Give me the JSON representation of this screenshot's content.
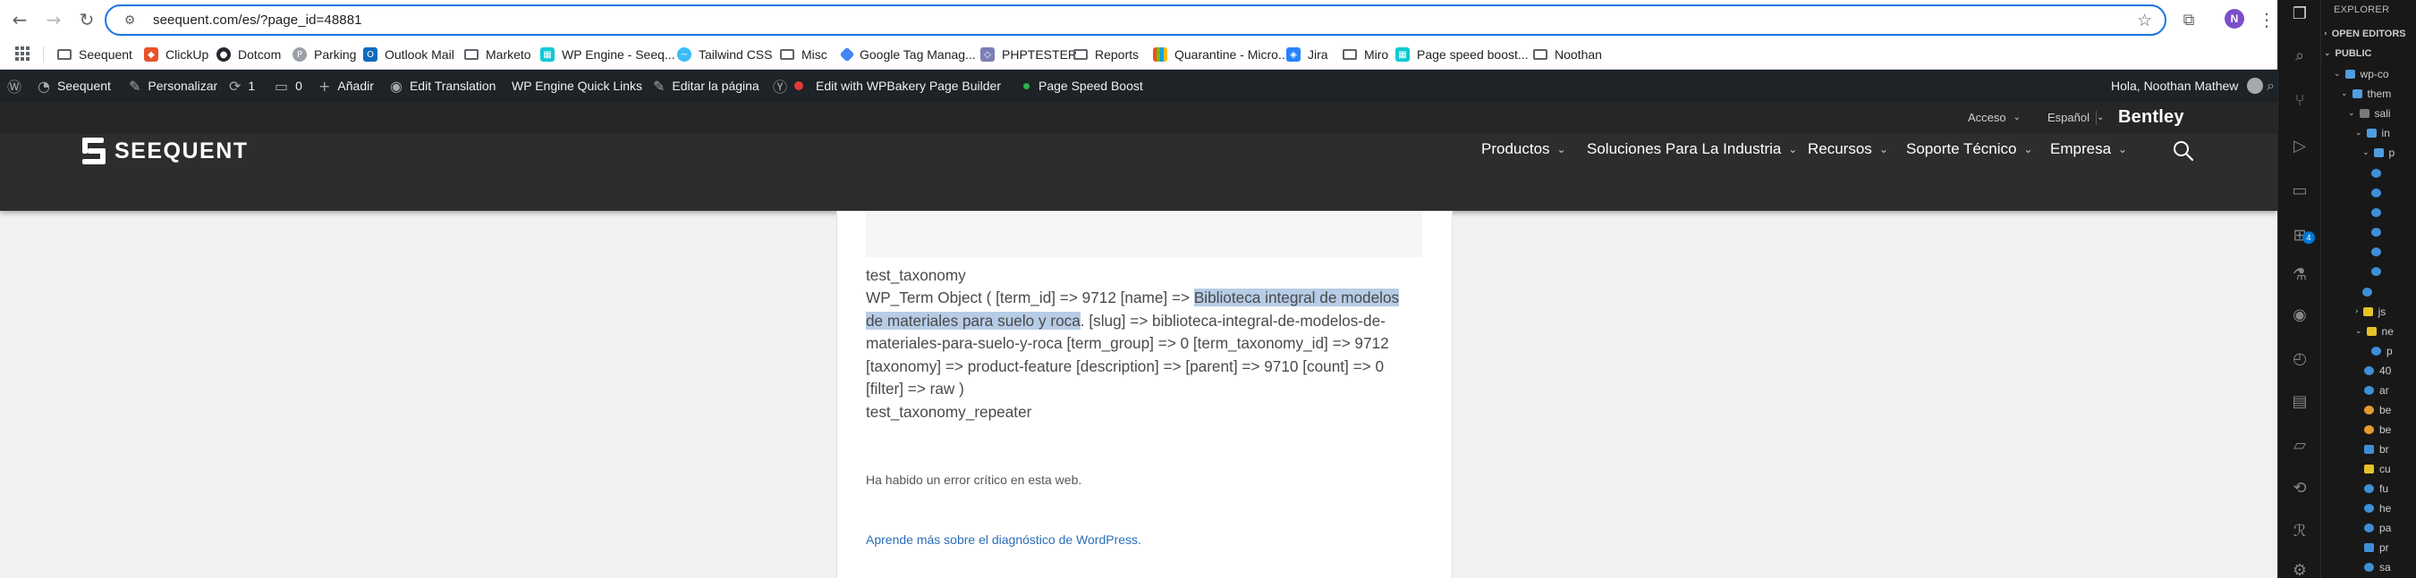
{
  "browser": {
    "url": "seequent.com/es/?page_id=48881",
    "profile_initial": "N",
    "bookmarks": [
      {
        "label": "Seequent",
        "icon": "folder-icon"
      },
      {
        "label": "ClickUp",
        "icon": "clickup-icon"
      },
      {
        "label": "Dotcom",
        "icon": "github-icon"
      },
      {
        "label": "Parking",
        "icon": "parking-icon"
      },
      {
        "label": "Outlook Mail",
        "icon": "outlook-icon"
      },
      {
        "label": "Marketo",
        "icon": "folder-icon"
      },
      {
        "label": "WP Engine - Seeq...",
        "icon": "wpengine-icon"
      },
      {
        "label": "Tailwind CSS",
        "icon": "tailwind-icon"
      },
      {
        "label": "Misc",
        "icon": "folder-icon"
      },
      {
        "label": "Google Tag Manag...",
        "icon": "gtm-icon"
      },
      {
        "label": "PHPTESTER",
        "icon": "php-icon"
      },
      {
        "label": "Reports",
        "icon": "folder-icon"
      },
      {
        "label": "Quarantine - Micro...",
        "icon": "microsoft-icon"
      },
      {
        "label": "Jira",
        "icon": "jira-icon"
      },
      {
        "label": "Miro",
        "icon": "folder-icon"
      },
      {
        "label": "Page speed boost...",
        "icon": "wpengine-icon"
      },
      {
        "label": "Noothan",
        "icon": "folder-icon"
      }
    ]
  },
  "admin_bar": {
    "site_name": "Seequent",
    "customize": "Personalizar",
    "updates_count": "1",
    "comments_count": "0",
    "add_new": "Añadir",
    "edit_translation": "Edit Translation",
    "wpe_links": "WP Engine Quick Links",
    "edit_page": "Editar la página",
    "wpbakery": "Edit with WPBakery Page Builder",
    "page_speed": "Page Speed Boost",
    "greeting": "Hola, Noothan Mathew"
  },
  "site_header": {
    "access": "Acceso",
    "language": "Español",
    "bentley": "Bentley",
    "logo_text": "SEEQUENT",
    "nav": [
      "Productos",
      "Soluciones Para La Industria",
      "Recursos",
      "Soporte Técnico",
      "Empresa"
    ]
  },
  "content": {
    "label_taxonomy": "test_taxonomy",
    "dump_prefix": "WP_Term Object ( [term_id] => 9712 [name] => ",
    "dump_highlight_1": "Biblioteca integral de modelos",
    "dump_highlight_2": "de materiales para suelo y roca",
    "dump_line2_rest": ". [slug] => biblioteca-integral-de-modelos-de-",
    "dump_line3": "materiales-para-suelo-y-roca [term_group] => 0 [term_taxonomy_id] => 9712",
    "dump_line4": "[taxonomy] => product-feature [description] => [parent] => 9710 [count] => 0",
    "dump_line5": "[filter] => raw )",
    "label_repeater": "test_taxonomy_repeater",
    "error_message": "Ha habido un error crítico en esta web.",
    "learn_more_link": "Aprende más sobre el diagnóstico de WordPress."
  },
  "vscode": {
    "explorer_title": "EXPLORER",
    "open_editors": "OPEN EDITORS",
    "tree": [
      {
        "label": "PUBLIC",
        "level": 0
      },
      {
        "label": "wp-co",
        "level": 1
      },
      {
        "label": "them",
        "level": 2
      },
      {
        "label": "sali",
        "level": 3
      },
      {
        "label": "in",
        "level": 4
      },
      {
        "label": "p",
        "level": 5
      },
      {
        "label": "js",
        "level": 4
      },
      {
        "label": "ne",
        "level": 4
      },
      {
        "label": "p",
        "level": 5
      },
      {
        "label": "40",
        "level": 4
      },
      {
        "label": "ar",
        "level": 4
      },
      {
        "label": "be",
        "level": 4
      },
      {
        "label": "be",
        "level": 4
      },
      {
        "label": "br",
        "level": 4
      },
      {
        "label": "cu",
        "level": 4
      },
      {
        "label": "fu",
        "level": 4
      },
      {
        "label": "he",
        "level": 4
      },
      {
        "label": "pa",
        "level": 4
      },
      {
        "label": "pr",
        "level": 4
      },
      {
        "label": "sa",
        "level": 4
      }
    ],
    "scm_badge": "4"
  },
  "colors": {
    "admin_bar_bg": "#1d2327",
    "header_bg": "#2d2d2d",
    "selection_highlight": "#b7cce6",
    "link": "#2a6dba",
    "omnibox_focus": "#1a73e8"
  }
}
